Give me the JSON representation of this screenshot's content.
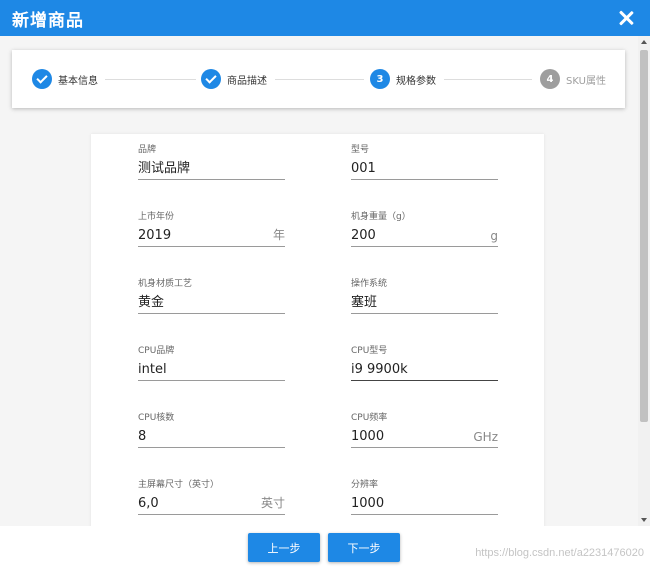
{
  "dialog": {
    "title": "新增商品"
  },
  "steps": [
    {
      "number": "1",
      "label": "基本信息",
      "state": "done"
    },
    {
      "number": "2",
      "label": "商品描述",
      "state": "done"
    },
    {
      "number": "3",
      "label": "规格参数",
      "state": "active"
    },
    {
      "number": "4",
      "label": "SKU属性",
      "state": "pending"
    }
  ],
  "fields": [
    {
      "label": "品牌",
      "value": "测试品牌",
      "suffix": ""
    },
    {
      "label": "型号",
      "value": "001",
      "suffix": ""
    },
    {
      "label": "上市年份",
      "value": "2019",
      "suffix": "年"
    },
    {
      "label": "机身重量（g）",
      "value": "200",
      "suffix": "g"
    },
    {
      "label": "机身材质工艺",
      "value": "黄金",
      "suffix": ""
    },
    {
      "label": "操作系统",
      "value": "塞班",
      "suffix": ""
    },
    {
      "label": "CPU品牌",
      "value": "intel",
      "suffix": ""
    },
    {
      "label": "CPU型号",
      "value": "i9 9900k",
      "suffix": ""
    },
    {
      "label": "CPU核数",
      "value": "8",
      "suffix": ""
    },
    {
      "label": "CPU频率",
      "value": "1000",
      "suffix": "GHz"
    },
    {
      "label": "主屏幕尺寸（英寸）",
      "value": "6,0",
      "suffix": "英寸"
    },
    {
      "label": "分辨率",
      "value": "1000",
      "suffix": ""
    }
  ],
  "footer": {
    "prev_label": "上一步",
    "next_label": "下一步",
    "watermark": "https://blog.csdn.net/a2231476020"
  },
  "colors": {
    "primary": "#1e88e5",
    "inactive": "#9e9e9e"
  }
}
